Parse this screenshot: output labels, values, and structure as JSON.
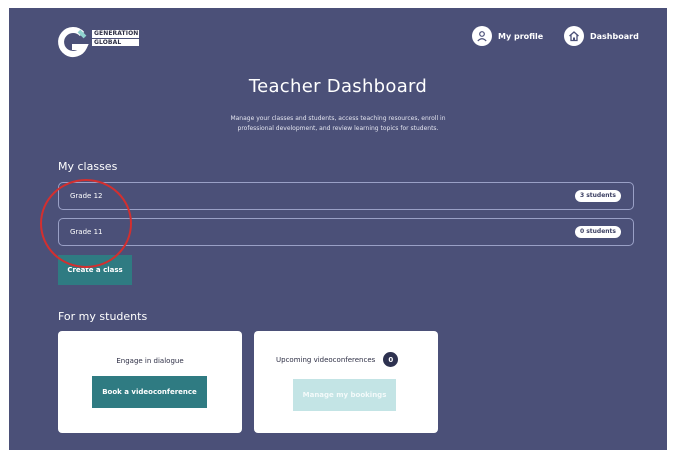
{
  "header": {
    "logo": {
      "line1": "GENERATION",
      "line2": "GLOBAL"
    },
    "nav": [
      {
        "label": "My profile",
        "icon": "user-icon"
      },
      {
        "label": "Dashboard",
        "icon": "home-icon"
      }
    ]
  },
  "page": {
    "title": "Teacher Dashboard",
    "subtitle": "Manage your classes and students, access teaching resources, enroll in professional development, and review learning topics for students."
  },
  "classes": {
    "heading": "My classes",
    "items": [
      {
        "name": "Grade 12",
        "badge": "3 students"
      },
      {
        "name": "Grade 11",
        "badge": "0 students"
      }
    ],
    "create_label": "Create a class"
  },
  "students": {
    "heading": "For my students",
    "cards": [
      {
        "title": "Engage in dialogue",
        "button": "Book a videoconference"
      },
      {
        "title": "Upcoming videoconferences",
        "count": "0",
        "button": "Manage my bookings"
      }
    ]
  },
  "colors": {
    "background": "#4b5078",
    "teal": "#2f7b82",
    "disabled_teal": "#c3e4e5",
    "annotation": "#d32f2f"
  }
}
